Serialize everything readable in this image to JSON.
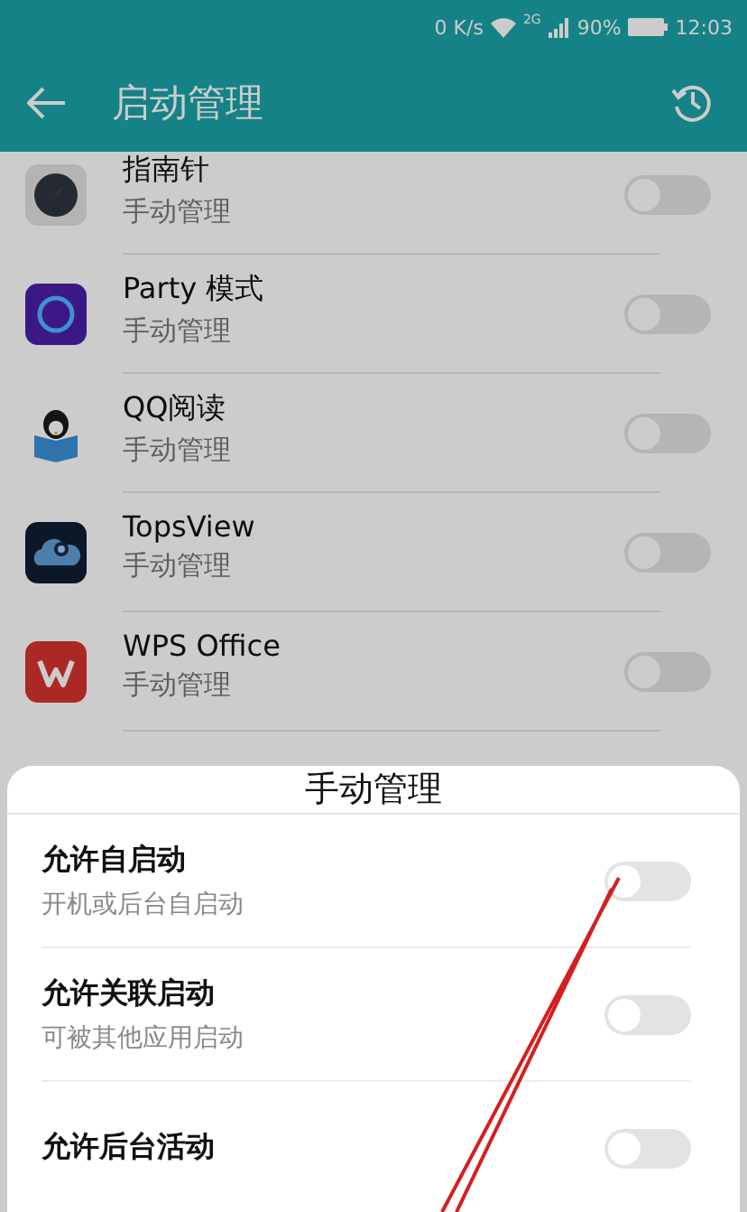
{
  "status_bar": {
    "speed": "0 K/s",
    "network": "2G",
    "battery": "90%",
    "time": "12:03"
  },
  "app_bar": {
    "title": "启动管理"
  },
  "apps": [
    {
      "name": "指南针",
      "mode": "手动管理",
      "on": false
    },
    {
      "name": "Party 模式",
      "mode": "手动管理",
      "on": false
    },
    {
      "name": "QQ阅读",
      "mode": "手动管理",
      "on": false
    },
    {
      "name": "TopsView",
      "mode": "手动管理",
      "on": false
    },
    {
      "name": "WPS Office",
      "mode": "手动管理",
      "on": false
    }
  ],
  "sheet": {
    "title": "手动管理",
    "options": [
      {
        "label": "允许自启动",
        "description": "开机或后台自启动",
        "on": false
      },
      {
        "label": "允许关联启动",
        "description": "可被其他应用启动",
        "on": false
      },
      {
        "label": "允许后台活动",
        "on": false
      }
    ]
  }
}
